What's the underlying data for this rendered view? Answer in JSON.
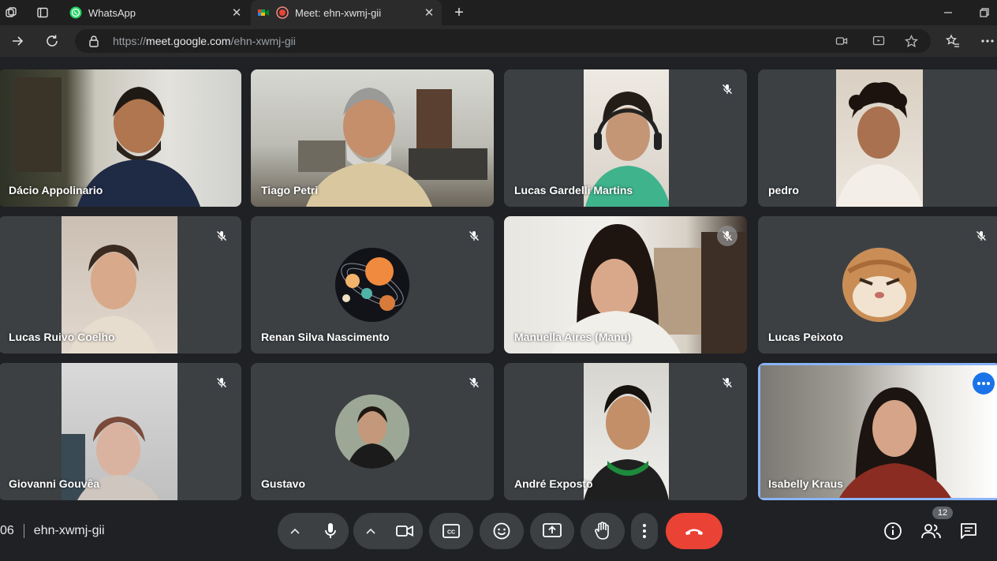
{
  "browser": {
    "tabs": [
      {
        "title": "WhatsApp",
        "favicon": "whatsapp-icon",
        "active": false
      },
      {
        "title": "Meet: ehn-xwmj-gii",
        "favicon": "google-meet-icon",
        "active": true,
        "recording": true
      }
    ],
    "address": {
      "scheme": "https://",
      "host": "meet.google.com",
      "path": "/ehn-xwmj-gii"
    }
  },
  "participants": [
    {
      "name": "Dácio Appolinario",
      "muted": false,
      "video": true
    },
    {
      "name": "Tiago Petri",
      "muted": false,
      "video": true
    },
    {
      "name": "Lucas Gardelli Martins",
      "muted": true,
      "video": true
    },
    {
      "name": "pedro",
      "muted": false,
      "video": true
    },
    {
      "name": "Lucas Ruivo Coelho",
      "muted": true,
      "video": true
    },
    {
      "name": "Renan Silva Nascimento",
      "muted": true,
      "video": false,
      "avatar": "planets"
    },
    {
      "name": "Manuella Aires (Manu)",
      "muted": true,
      "video": true
    },
    {
      "name": "Lucas Peixoto",
      "muted": true,
      "video": false,
      "avatar": "cat"
    },
    {
      "name": "Giovanni Gouvêa",
      "muted": true,
      "video": true
    },
    {
      "name": "Gustavo",
      "muted": true,
      "video": false,
      "avatar": "person"
    },
    {
      "name": "André Exposto",
      "muted": true,
      "video": true
    },
    {
      "name": "Isabelly Kraus",
      "muted": false,
      "video": true,
      "speaking": true
    }
  ],
  "meeting": {
    "time_fragment": "06",
    "code": "ehn-xwmj-gii",
    "participant_count": "12"
  },
  "colors": {
    "end_call": "#ea4335",
    "speaking_accent": "#1a73e8",
    "tile_bg": "#3c4043",
    "stage_bg": "#202124"
  }
}
